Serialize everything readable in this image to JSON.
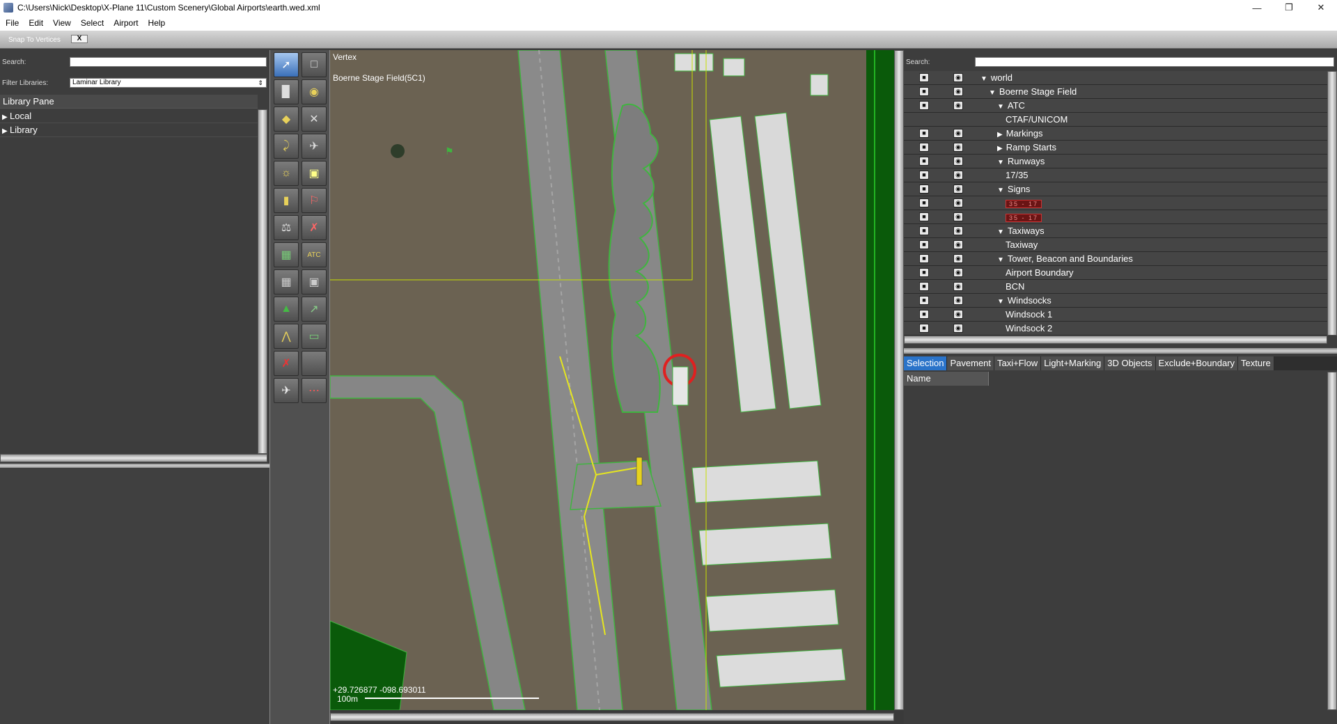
{
  "window": {
    "title": "C:\\Users\\Nick\\Desktop\\X-Plane 11\\Custom Scenery\\Global Airports\\earth.wed.xml",
    "min": "—",
    "max": "❐",
    "close": "✕"
  },
  "menu": [
    "File",
    "Edit",
    "View",
    "Select",
    "Airport",
    "Help"
  ],
  "toolbar": {
    "snap_label": "Snap To Vertices",
    "snap_toggle": "X"
  },
  "left": {
    "search_label": "Search:",
    "search_value": "",
    "filter_label": "Filter Libraries:",
    "filter_value": "Laminar Library",
    "pane_title": "Library Pane",
    "items": [
      {
        "tri": "▶",
        "label": "Local"
      },
      {
        "tri": "▶",
        "label": "Library"
      }
    ]
  },
  "map": {
    "tool_name": "Vertex",
    "airport": "Boerne Stage Field(5C1)",
    "coords": "+29.726877 -098.693011",
    "scale": "100m"
  },
  "right": {
    "search_label": "Search:",
    "search_value": "",
    "tree": [
      {
        "tri": "▼",
        "label": "world",
        "level": 0,
        "lock": true,
        "eye": true
      },
      {
        "tri": "▼",
        "label": "Boerne Stage Field",
        "level": 1,
        "lock": true,
        "eye": true
      },
      {
        "tri": "▼",
        "label": "ATC",
        "level": 2,
        "lock": true,
        "eye": true
      },
      {
        "tri": "",
        "label": "CTAF/UNICOM",
        "level": 3,
        "lock": false,
        "eye": false
      },
      {
        "tri": "▶",
        "label": "Markings",
        "level": 2,
        "lock": true,
        "eye": true
      },
      {
        "tri": "▶",
        "label": "Ramp Starts",
        "level": 2,
        "lock": true,
        "eye": true
      },
      {
        "tri": "▼",
        "label": "Runways",
        "level": 2,
        "lock": true,
        "eye": true
      },
      {
        "tri": "",
        "label": "17/35",
        "level": 3,
        "lock": true,
        "eye": true
      },
      {
        "tri": "▼",
        "label": "Signs",
        "level": 2,
        "lock": true,
        "eye": true
      },
      {
        "tri": "",
        "label": "35 - 17",
        "level": 3,
        "lock": true,
        "eye": true,
        "sign": true
      },
      {
        "tri": "",
        "label": "35 - 17",
        "level": 3,
        "lock": true,
        "eye": true,
        "sign": true
      },
      {
        "tri": "▼",
        "label": "Taxiways",
        "level": 2,
        "lock": true,
        "eye": true
      },
      {
        "tri": "",
        "label": "Taxiway",
        "level": 3,
        "lock": true,
        "eye": true
      },
      {
        "tri": "▼",
        "label": "Tower, Beacon and Boundaries",
        "level": 2,
        "lock": true,
        "eye": true
      },
      {
        "tri": "",
        "label": "Airport Boundary",
        "level": 3,
        "lock": true,
        "eye": true
      },
      {
        "tri": "",
        "label": "BCN",
        "level": 3,
        "lock": true,
        "eye": true
      },
      {
        "tri": "▼",
        "label": "Windsocks",
        "level": 2,
        "lock": true,
        "eye": true
      },
      {
        "tri": "",
        "label": "Windsock 1",
        "level": 3,
        "lock": true,
        "eye": true
      },
      {
        "tri": "",
        "label": "Windsock 2",
        "level": 3,
        "lock": true,
        "eye": true
      }
    ],
    "tabs": [
      "Selection",
      "Pavement",
      "Taxi+Flow",
      "Light+Marking",
      "3D Objects",
      "Exclude+Boundary",
      "Texture"
    ],
    "active_tab": "Selection",
    "name_header": "Name"
  },
  "tools": [
    "marquee-icon",
    "vertex-icon",
    "runway-icon",
    "helipad-icon",
    "taxiway-icon",
    "hole-icon",
    "taxiline-icon",
    "boundary-icon",
    "light-icon",
    "sign-icon",
    "object-icon",
    "windsock-icon",
    "beacon-icon",
    "tower-icon",
    "facade-icon",
    "atc-flow-icon",
    "forest-icon",
    "line-icon",
    "string-icon",
    "polygon-icon",
    "exclude-icon",
    "draped-icon",
    "ramp-start-icon",
    "truck-icon"
  ],
  "colors": {
    "ground": "#6b6252",
    "pavement": "#8a8a8a",
    "selection_green": "#3fb53f",
    "taxiline": "#e6e61e",
    "circle": "#e02020",
    "boundary_green": "#0a5a0a"
  }
}
